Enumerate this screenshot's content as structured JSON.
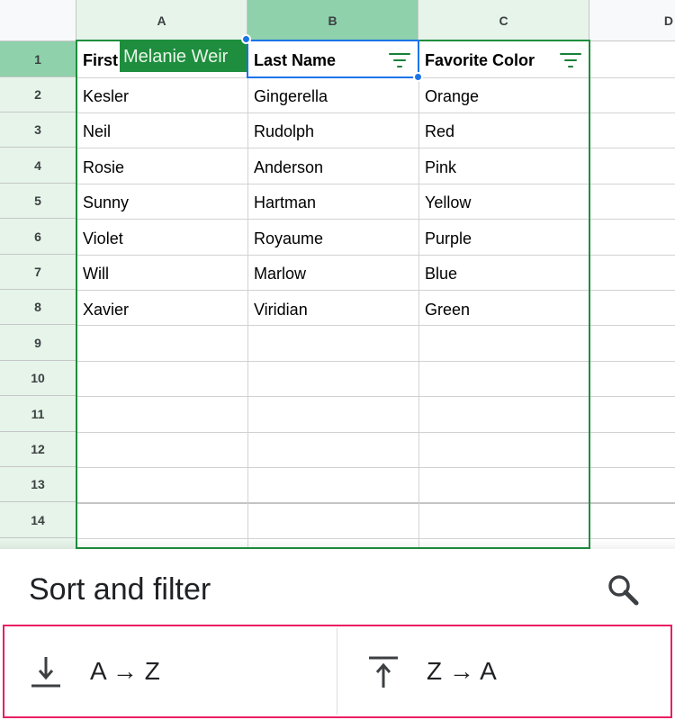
{
  "columns": [
    "A",
    "B",
    "C",
    "D"
  ],
  "rows": [
    "1",
    "2",
    "3",
    "4",
    "5",
    "6",
    "7",
    "8",
    "9",
    "10",
    "11",
    "12",
    "13",
    "14"
  ],
  "header_cells": {
    "a1": "First",
    "b1": "Last Name",
    "c1": "Favorite Color"
  },
  "data_rows": [
    [
      "Kesler",
      "Gingerella",
      "Orange"
    ],
    [
      "Neil",
      "Rudolph",
      "Red"
    ],
    [
      "Rosie",
      "Anderson",
      "Pink"
    ],
    [
      "Sunny",
      "Hartman",
      "Yellow"
    ],
    [
      "Violet",
      "Royaume",
      "Purple"
    ],
    [
      "Will",
      "Marlow",
      "Blue"
    ],
    [
      "Xavier",
      "Viridian",
      "Green"
    ]
  ],
  "collaborator": {
    "name": "Melanie Weir",
    "color": "#1e8e3e"
  },
  "bottom_sheet": {
    "title": "Sort and filter",
    "search_icon": "search-icon",
    "sort_asc": {
      "label": "A → Z",
      "icon": "sort-ascending-icon"
    },
    "sort_desc": {
      "label": "Z → A",
      "icon": "sort-descending-icon"
    }
  },
  "colors": {
    "selection_green": "#1e8e3e",
    "active_blue": "#1a73e8",
    "highlight_pink": "#e91e63"
  }
}
